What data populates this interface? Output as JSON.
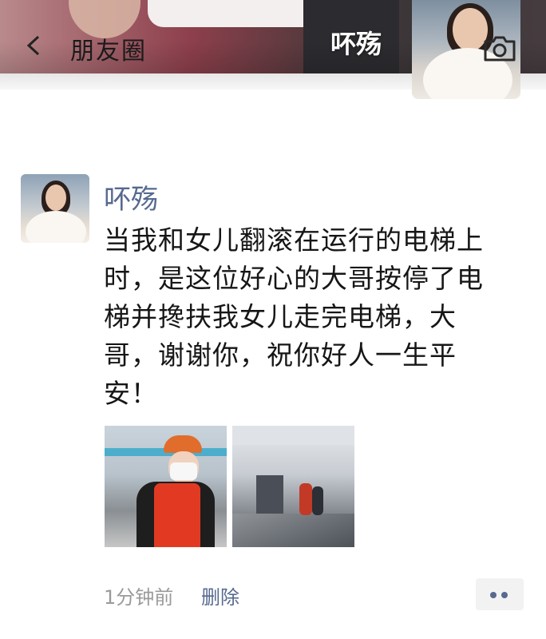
{
  "header": {
    "title": "朋友圈",
    "cover_username": "吥殇",
    "back_icon": "chevron-left-icon",
    "camera_icon": "camera-icon"
  },
  "post": {
    "username": "吥殇",
    "text": "当我和女儿翻滚在运行的电梯上时，是这位好心的大哥按停了电梯并搀扶我女儿走完电梯，大哥，谢谢你，祝你好人一生平安！",
    "time": "1分钟前",
    "delete_label": "删除",
    "more_icon": "more-dots-icon"
  },
  "colors": {
    "link": "#56698f",
    "text": "#161616",
    "meta": "#9a9a9a"
  }
}
